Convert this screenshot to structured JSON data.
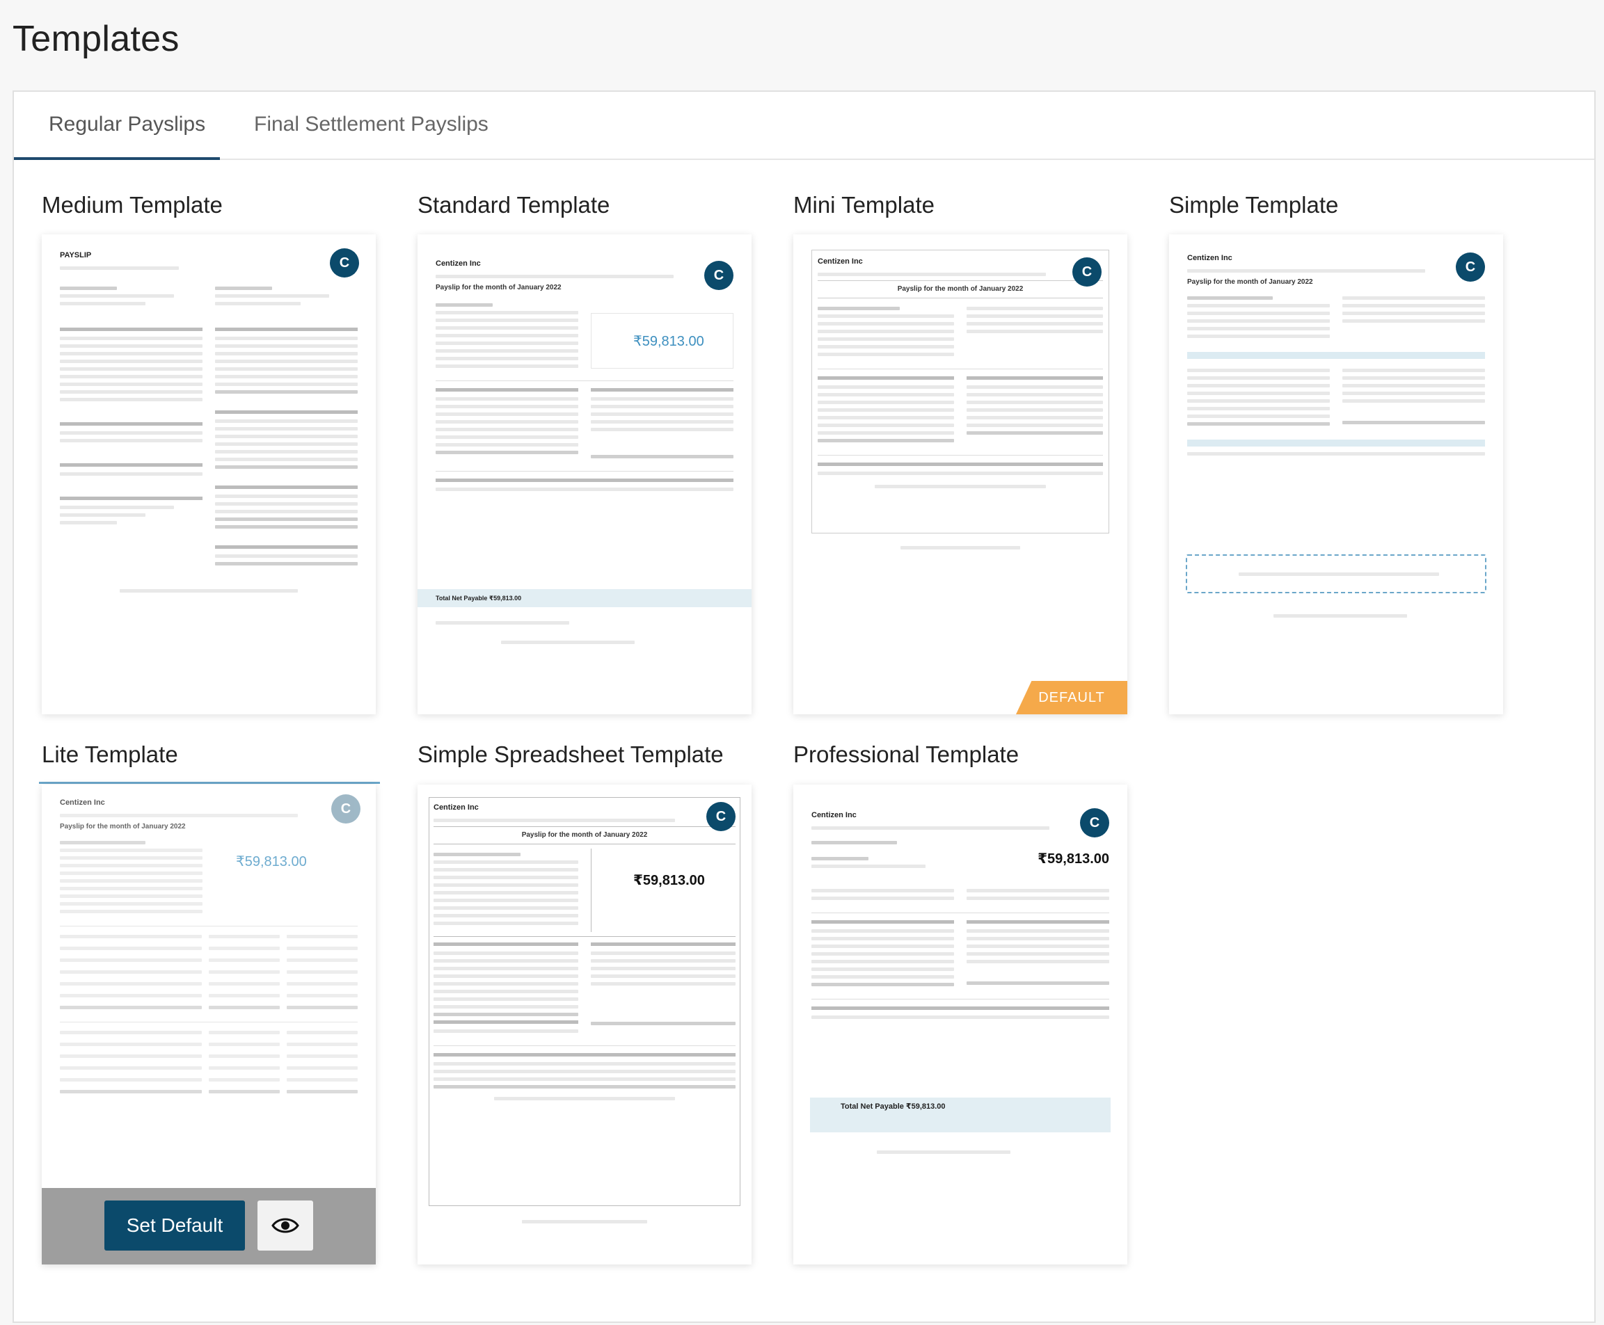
{
  "page": {
    "title": "Templates"
  },
  "tabs": [
    {
      "label": "Regular Payslips"
    },
    {
      "label": "Final Settlement Payslips"
    }
  ],
  "templates": [
    {
      "title": "Medium Template"
    },
    {
      "title": "Standard Template"
    },
    {
      "title": "Mini Template",
      "badge": "DEFAULT"
    },
    {
      "title": "Simple Template"
    },
    {
      "title": "Lite Template",
      "set_default_label": "Set Default"
    },
    {
      "title": "Simple Spreadsheet Template"
    },
    {
      "title": "Professional Template"
    }
  ],
  "preview": {
    "company": "Centizen Inc",
    "payslip_label": "PAYSLIP",
    "period_heading": "Payslip for the month of January 2022",
    "net_pay": "₹59,813.00",
    "avatar_letter": "C",
    "net_payable_line": "Total Net Payable ₹59,813.00"
  },
  "colors": {
    "accent": "#0b4a6b",
    "badge": "#f5a94a",
    "tab_underline": "#1e4a6d"
  }
}
